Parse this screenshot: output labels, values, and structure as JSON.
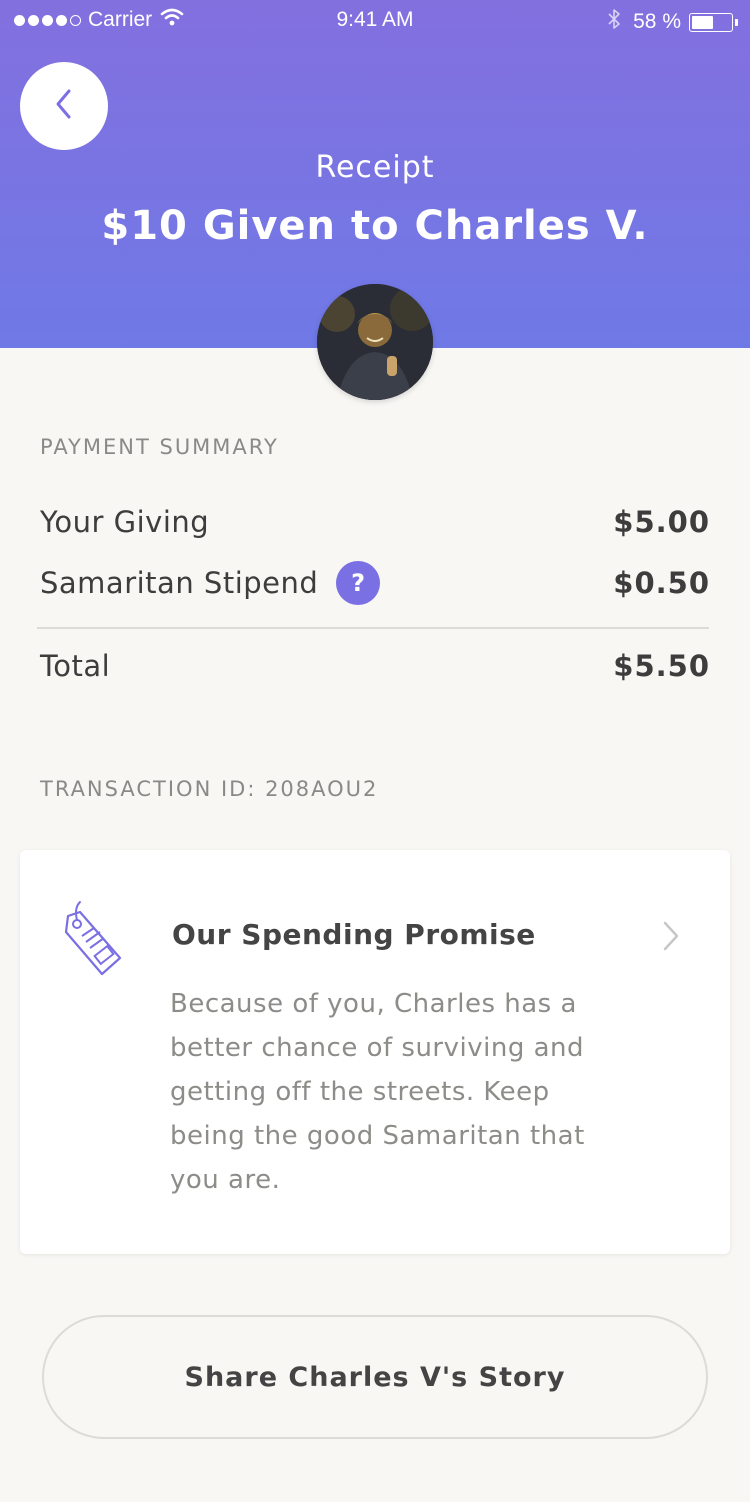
{
  "status_bar": {
    "carrier": "Carrier",
    "time": "9:41 AM",
    "battery_percent": "58 %",
    "battery_level": 0.58,
    "signal_bars": 4
  },
  "header": {
    "label": "Receipt",
    "title": "$10 Given to Charles V."
  },
  "payment_summary": {
    "heading": "PAYMENT SUMMARY",
    "items": [
      {
        "label": "Your Giving",
        "amount": "$5.00"
      },
      {
        "label": "Samaritan Stipend",
        "amount": "$0.50",
        "help_label": "?"
      }
    ],
    "total_label": "Total",
    "total_amount": "$5.50"
  },
  "transaction": {
    "label": "TRANSACTION ID: 208AOU2"
  },
  "promise_card": {
    "title": "Our Spending Promise",
    "body": "Because of you, Charles has a better chance of surviving and getting off the streets. Keep being the good Samaritan that you are.",
    "icon": "price-tag-icon"
  },
  "share_button": {
    "label": "Share Charles V's Story"
  },
  "colors": {
    "accent": "#7a6fe3",
    "header_top": "#8370df",
    "header_bottom": "#6f79e6",
    "background": "#f8f7f4"
  }
}
